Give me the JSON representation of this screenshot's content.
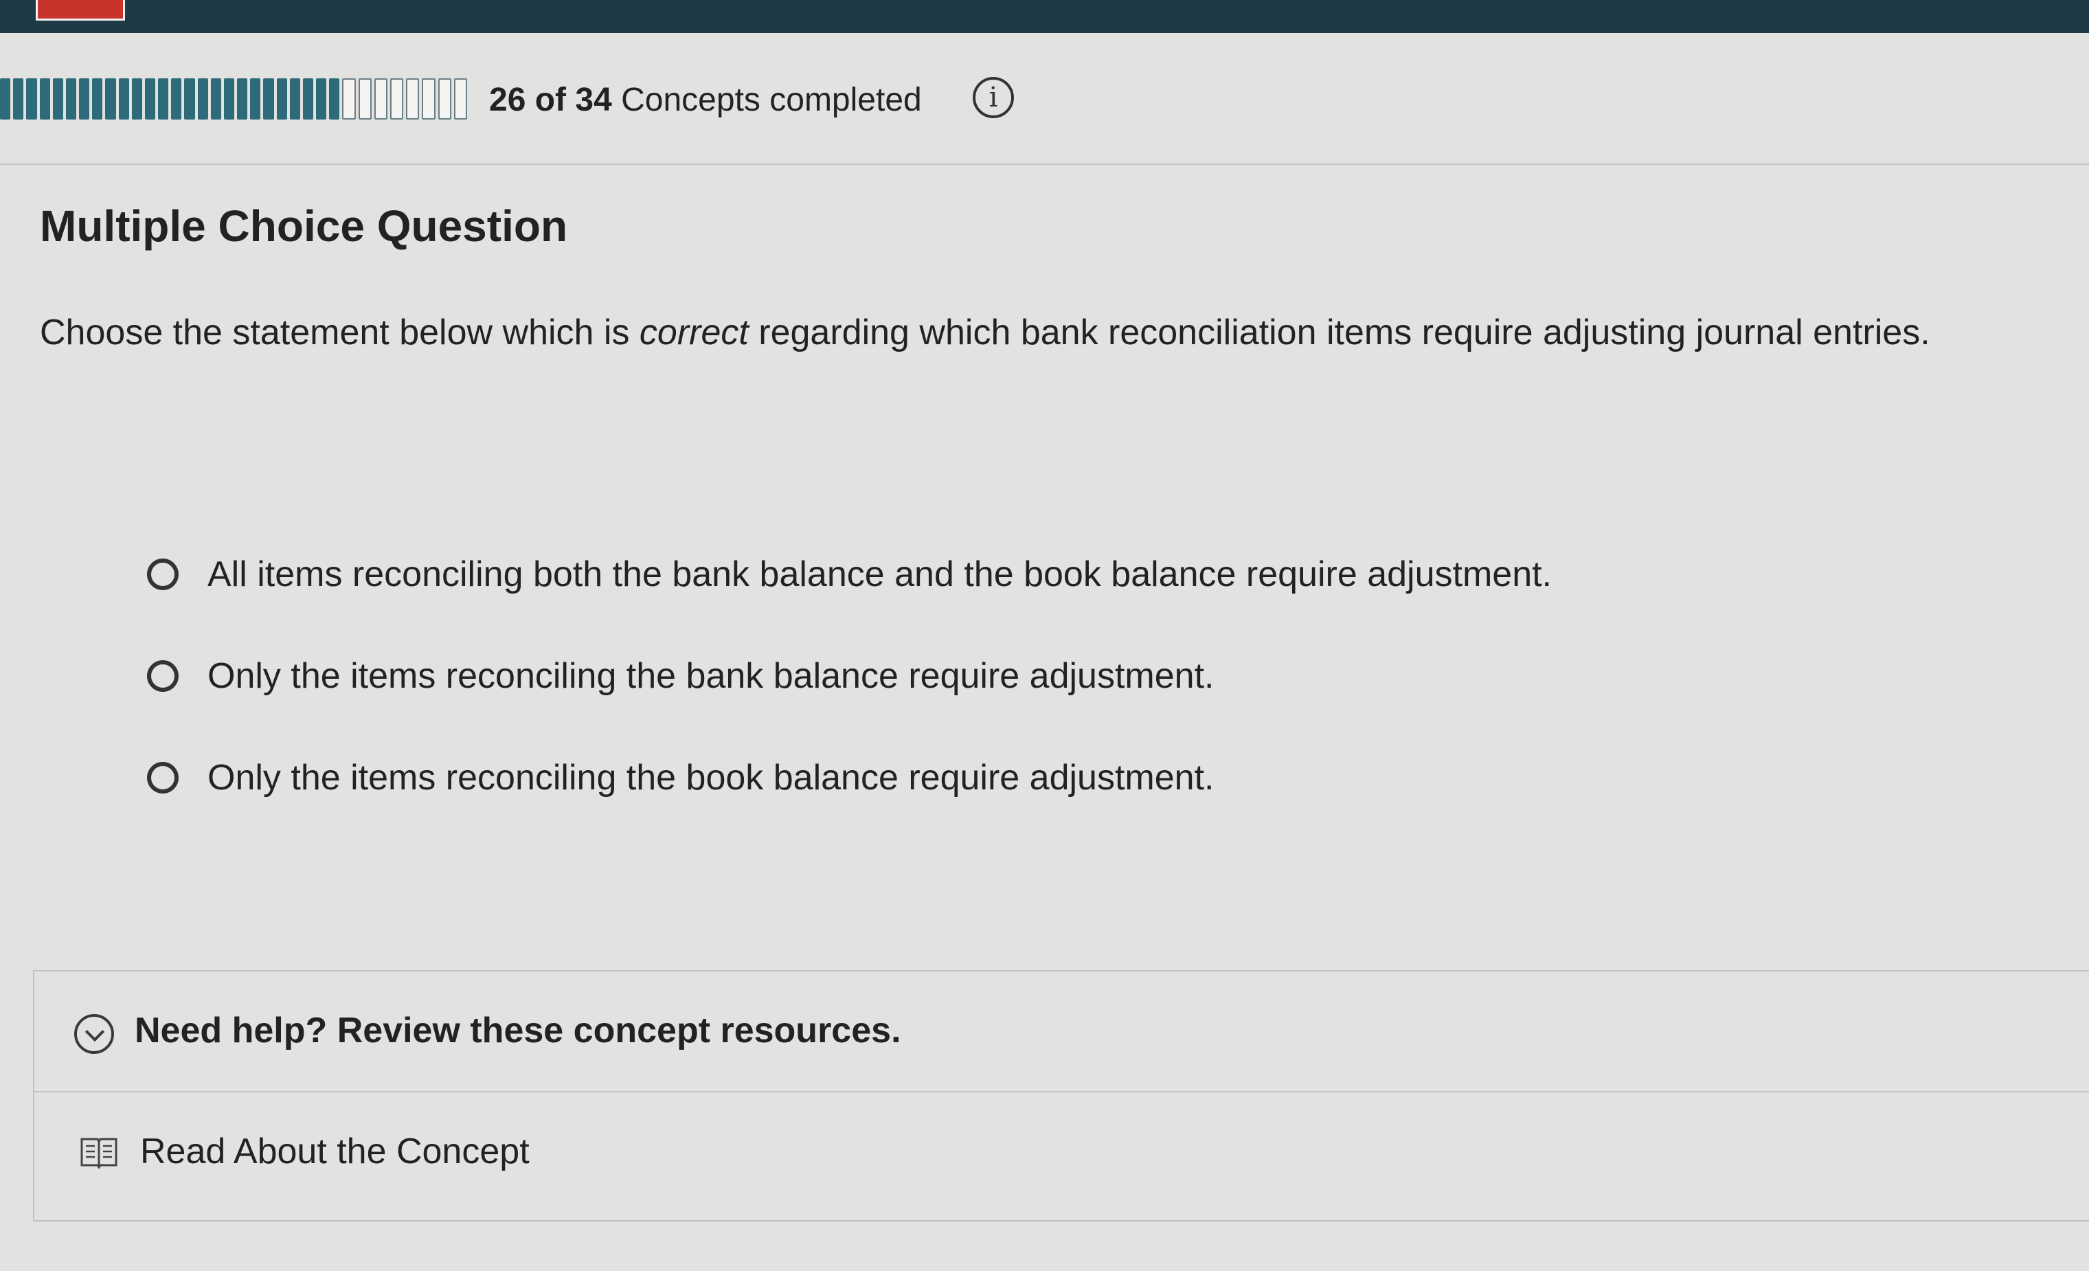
{
  "progress": {
    "completed": "26",
    "total": "34",
    "of_word": "of",
    "suffix": "Concepts completed",
    "completed_count": 26,
    "total_count": 34
  },
  "question": {
    "type_label": "Multiple Choice Question",
    "prompt_before": "Choose the statement below which is ",
    "prompt_emphasis": "correct",
    "prompt_after": " regarding which bank reconciliation items require adjusting journal entries.",
    "options": [
      {
        "label": "All items reconciling both the bank balance and the book balance require adjustment."
      },
      {
        "label": "Only the items reconciling the bank balance require adjustment."
      },
      {
        "label": "Only the items reconciling the book balance require adjustment."
      }
    ]
  },
  "help": {
    "title": "Need help? Review these concept resources.",
    "resources": [
      {
        "label": "Read About the Concept",
        "icon": "book-icon"
      }
    ]
  },
  "colors": {
    "topbar": "#1f3a45",
    "progress_done": "#2d6b7a",
    "brand": "#c8332b"
  },
  "icons": {
    "info": "info-icon",
    "help_toggle": "chevron-down-icon",
    "radio": "radio-icon"
  }
}
